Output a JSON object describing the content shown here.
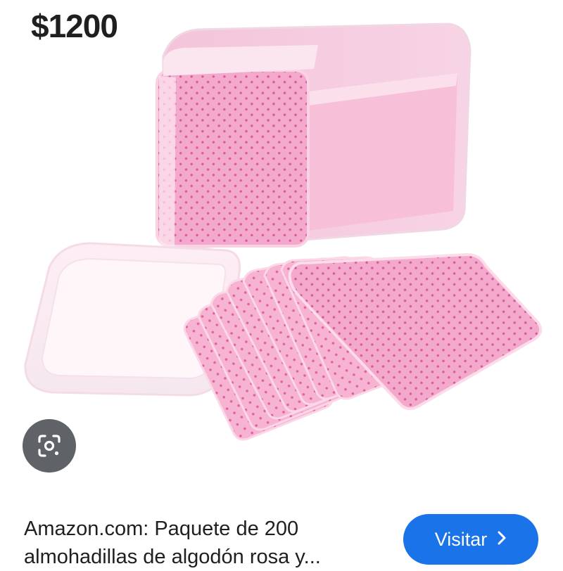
{
  "result": {
    "price": "$1200",
    "title_line1": "Amazon.com: Paquete de 200",
    "title_line2": "almohadillas de algodón rosa y...",
    "visit_label": "Visitar",
    "visit_icon": "chevron-right-icon",
    "lens_icon": "google-lens-icon"
  },
  "colors": {
    "pad_pink": "#f3a9cc",
    "dot_pink": "#e0569a",
    "button_blue": "#1a73e8",
    "lens_bg": "#5f6368"
  }
}
